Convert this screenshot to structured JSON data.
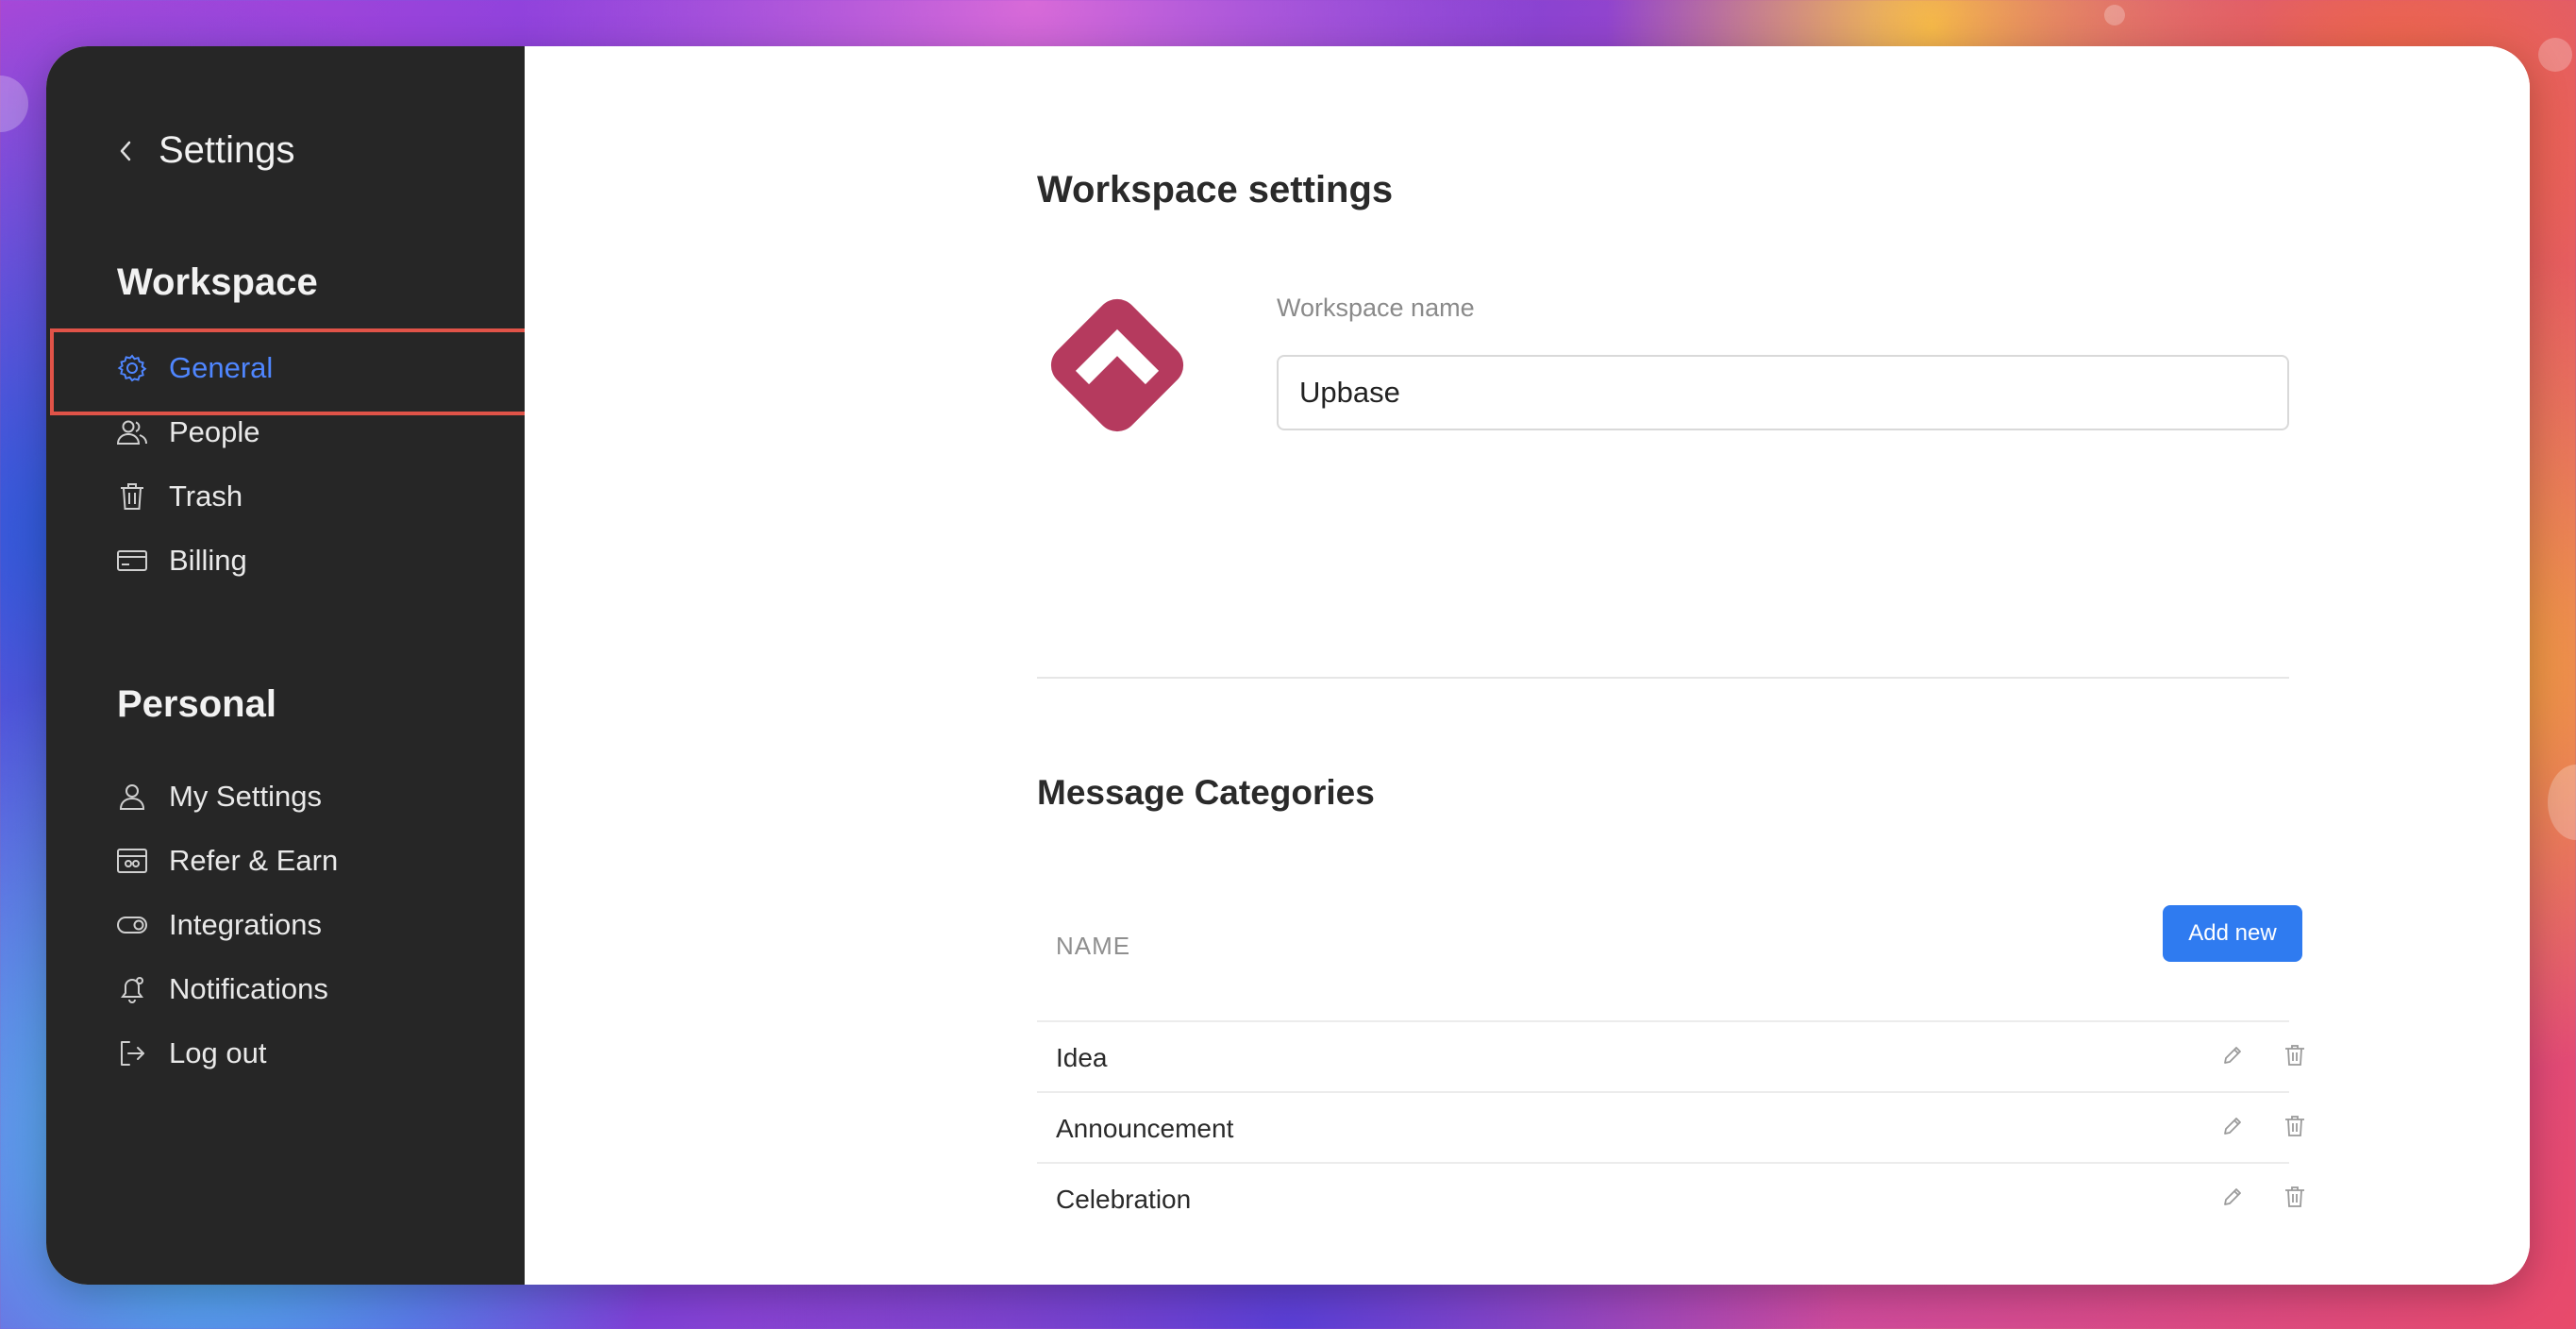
{
  "sidebar": {
    "title": "Settings",
    "workspace_heading": "Workspace",
    "workspace_items": [
      {
        "label": "General",
        "icon": "gear-icon",
        "active": true
      },
      {
        "label": "People",
        "icon": "people-icon"
      },
      {
        "label": "Trash",
        "icon": "trash-icon"
      },
      {
        "label": "Billing",
        "icon": "credit-card-icon"
      }
    ],
    "personal_heading": "Personal",
    "personal_items": [
      {
        "label": "My Settings",
        "icon": "user-icon"
      },
      {
        "label": "Refer & Earn",
        "icon": "gift-card-icon"
      },
      {
        "label": "Integrations",
        "icon": "toggle-icon"
      },
      {
        "label": "Notifications",
        "icon": "bell-icon"
      },
      {
        "label": "Log out",
        "icon": "logout-icon"
      }
    ]
  },
  "main": {
    "title": "Workspace settings",
    "workspace_name_label": "Workspace name",
    "workspace_name_value": "Upbase",
    "categories_title": "Message Categories",
    "column_name": "NAME",
    "add_new_label": "Add new",
    "categories": [
      {
        "label": "Idea"
      },
      {
        "label": "Announcement"
      },
      {
        "label": "Celebration"
      }
    ]
  },
  "colors": {
    "sidebar_bg": "#262626",
    "active_blue": "#4f86ff",
    "highlight_red": "#e05348",
    "logo_pink": "#b53a5e",
    "button_blue": "#2f7bf0"
  }
}
